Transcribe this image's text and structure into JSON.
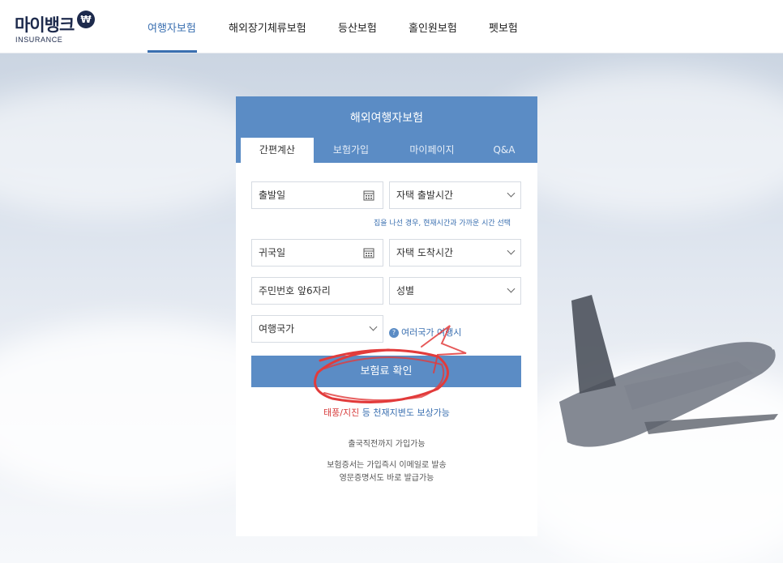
{
  "header": {
    "logo": {
      "main": "마이뱅크",
      "badge": "₩",
      "sub": "INSURANCE"
    },
    "nav": [
      {
        "label": "여행자보험",
        "active": true
      },
      {
        "label": "해외장기체류보험",
        "active": false
      },
      {
        "label": "등산보험",
        "active": false
      },
      {
        "label": "홀인원보험",
        "active": false
      },
      {
        "label": "펫보험",
        "active": false
      }
    ]
  },
  "card": {
    "title": "해외여행자보험",
    "tabs": [
      {
        "label": "간편계산",
        "active": true
      },
      {
        "label": "보험가입",
        "active": false
      },
      {
        "label": "마이페이지",
        "active": false
      },
      {
        "label": "Q&A",
        "active": false
      }
    ],
    "form": {
      "departure_date": "출발일",
      "departure_time": "자택 출발시간",
      "time_hint": "집을 나선 경우, 현재시간과 가까운 시간 선택",
      "return_date": "귀국일",
      "arrival_time": "자택 도착시간",
      "id_number": "주민번호 앞6자리",
      "gender": "성별",
      "country": "여행국가",
      "multi_country_icon": "?",
      "multi_country": "여러국가 여행시",
      "submit": "보험료 확인"
    },
    "notice": {
      "highlight": "태풍/지진",
      "rest": " 등 천재지변도 보상가능"
    },
    "info": [
      "출국직전까지 가입가능",
      "보험증서는 가입즉시 이메일로 발송",
      "영문증명서도 바로 발급가능"
    ]
  },
  "colors": {
    "brand_navy": "#1d2a4c",
    "accent_blue": "#5b8cc5",
    "link_blue": "#3a6fb0",
    "alert_red": "#d73b3b"
  },
  "icons": [
    "calendar-icon",
    "chevron-down-icon",
    "question-icon"
  ]
}
